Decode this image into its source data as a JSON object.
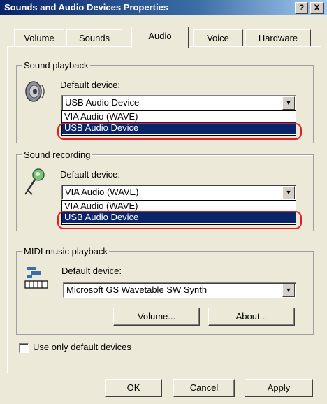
{
  "window": {
    "title": "Sounds and Audio Devices Properties",
    "help_label": "?",
    "close_label": "X"
  },
  "tabs": [
    {
      "label": "Volume",
      "active": false
    },
    {
      "label": "Sounds",
      "active": false
    },
    {
      "label": "Audio",
      "active": true
    },
    {
      "label": "Voice",
      "active": false
    },
    {
      "label": "Hardware",
      "active": false
    }
  ],
  "playback": {
    "legend": "Sound playback",
    "default_label": "Default device:",
    "selected": "USB Audio Device",
    "options": [
      "VIA Audio (WAVE)",
      "USB Audio Device"
    ],
    "icon": "speaker-icon"
  },
  "recording": {
    "legend": "Sound recording",
    "default_label": "Default device:",
    "selected": "VIA Audio (WAVE)",
    "options": [
      "VIA Audio (WAVE)",
      "USB Audio Device"
    ],
    "icon": "microphone-icon"
  },
  "midi": {
    "legend": "MIDI music playback",
    "default_label": "Default device:",
    "selected": "Microsoft GS Wavetable SW Synth",
    "volume_label": "Volume...",
    "about_label": "About...",
    "icon": "keyboard-icon"
  },
  "use_default_label": "Use only default devices",
  "buttons": {
    "ok": "OK",
    "cancel": "Cancel",
    "apply": "Apply"
  },
  "colors": {
    "selection": "#0a246a",
    "highlight_ring": "#e02020",
    "dialog_bg": "#ece9d8"
  }
}
